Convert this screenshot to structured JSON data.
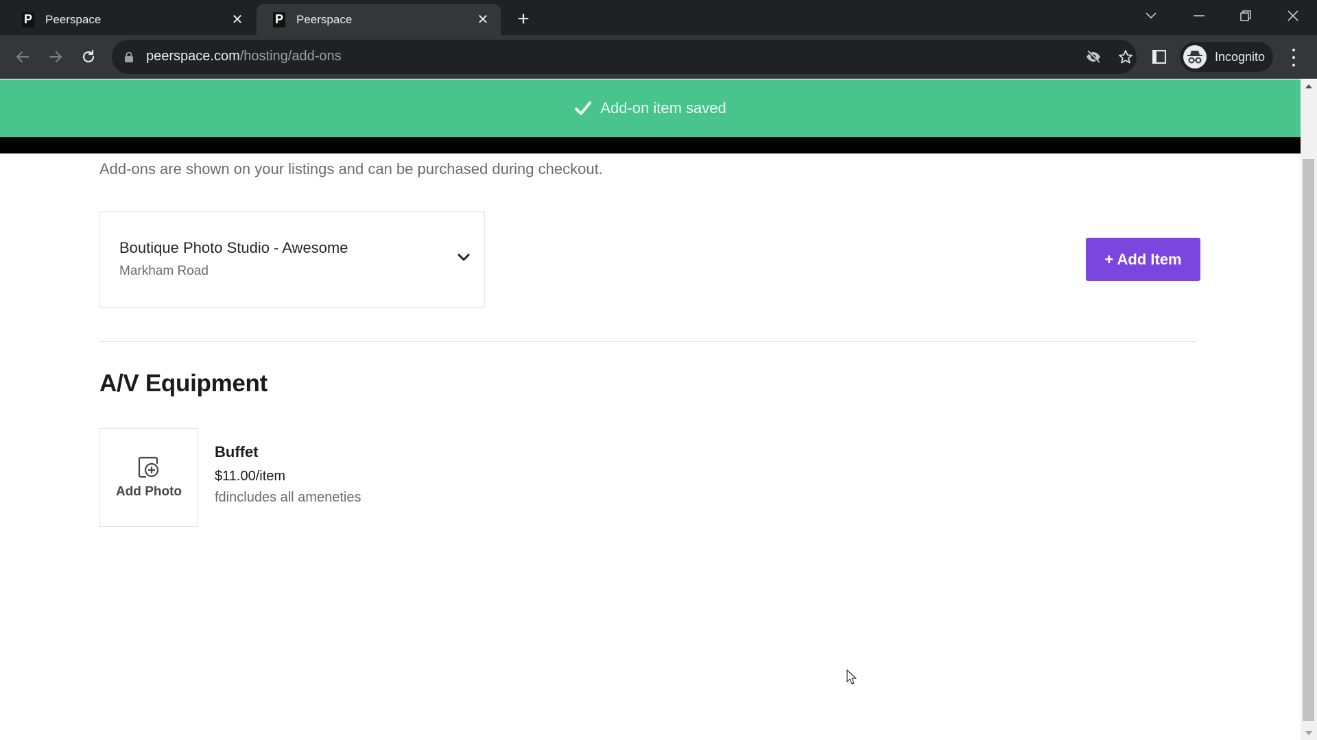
{
  "browser": {
    "tabs": [
      {
        "title": "Peerspace",
        "favicon": "P",
        "active": false
      },
      {
        "title": "Peerspace",
        "favicon": "P",
        "active": true
      }
    ],
    "url_host": "peerspace.com",
    "url_path": "/hosting/add-ons",
    "profile_label": "Incognito"
  },
  "toast": {
    "icon": "check-icon",
    "message": "Add-on item saved",
    "color": "#4ac48d"
  },
  "page": {
    "description": "Add-ons are shown on your listings and can be purchased during checkout.",
    "listing_select": {
      "name": "Boutique Photo Studio - Awesome",
      "location": "Markham Road"
    },
    "add_item_label": "+ Add Item",
    "accent_color": "#7b46e0",
    "sections": [
      {
        "title": "A/V Equipment",
        "items": [
          {
            "photo_label": "Add Photo",
            "name": "Buffet",
            "price": "$11.00/item",
            "description": "fdincludes all ameneties"
          }
        ]
      }
    ]
  }
}
